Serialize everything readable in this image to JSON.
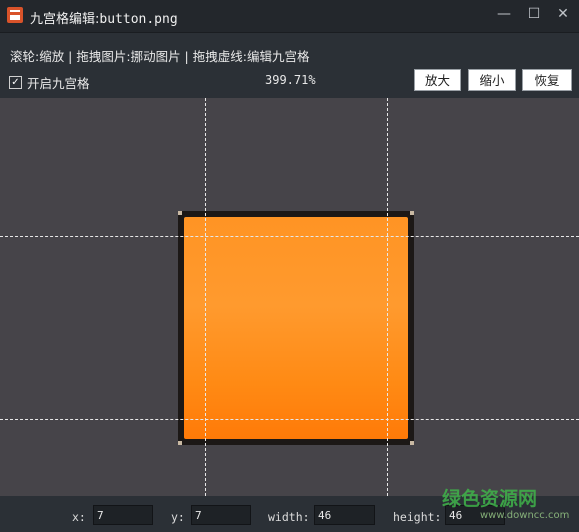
{
  "window": {
    "title_prefix": "九宫格编辑:",
    "title_file": "button.png",
    "minimize_glyph": "—",
    "maximize_glyph": "☐",
    "close_glyph": "✕"
  },
  "toolbar": {
    "hint": "滚轮:缩放 | 拖拽图片:挪动图片 | 拖拽虚线:编辑九宫格",
    "enable_nine_grid_label": "开启九宫格",
    "enable_nine_grid_checked": true,
    "zoom_level": "399.71%",
    "zoom_in_label": "放大",
    "zoom_out_label": "缩小",
    "reset_label": "恢复"
  },
  "canvas": {
    "background": "#464449",
    "image_fill": "#ff8c1a",
    "image_border": "#1c1816",
    "guide_color": "#e8e8e8"
  },
  "footer": {
    "x_label": "x:",
    "x_value": "7",
    "y_label": "y:",
    "y_value": "7",
    "width_label": "width:",
    "width_value": "46",
    "height_label": "height:",
    "height_value": "46"
  },
  "watermark": {
    "text": "绿色资源网",
    "sub": "www.downcc.com"
  }
}
